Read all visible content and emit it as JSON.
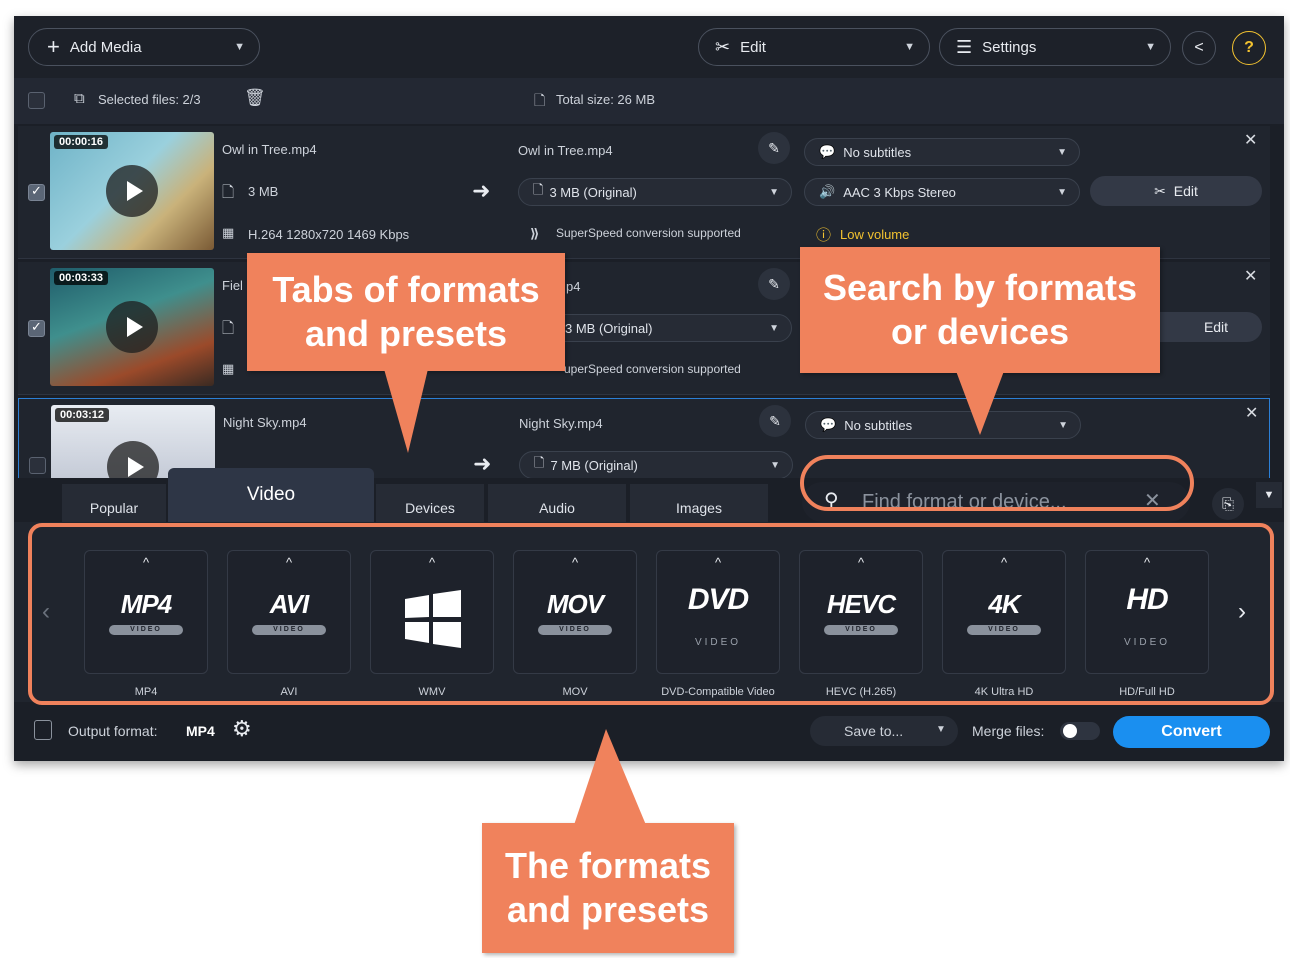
{
  "toolbar": {
    "add_media": "Add Media",
    "edit": "Edit",
    "settings": "Settings",
    "share_icon": "share-icon",
    "help": "?"
  },
  "selection": {
    "selected_files": "Selected files: 2/3",
    "total_size": "Total size: 26 MB"
  },
  "files": [
    {
      "duration": "00:00:16",
      "name": "Owl in Tree.mp4",
      "size": "3 MB",
      "codec": "H.264 1280x720 1469 Kbps",
      "output_name": "Owl in Tree.mp4",
      "output_size": "3 MB (Original)",
      "superspeed": "SuperSpeed conversion supported",
      "subtitles": "No subtitles",
      "audio": "AAC 3 Kbps Stereo",
      "warning": "Low volume",
      "edit": "Edit",
      "checked": true
    },
    {
      "duration": "00:03:33",
      "name": "Fiel",
      "output_name": "p4",
      "output_size": "3 MB (Original)",
      "superspeed": "uperSpeed conversion supported",
      "edit": "Edit",
      "checked": true
    },
    {
      "duration": "00:03:12",
      "name": "Night Sky.mp4",
      "output_name": "Night Sky.mp4",
      "output_size": "7 MB (Original)",
      "subtitles": "No subtitles",
      "checked": false
    }
  ],
  "search": {
    "placeholder": "Find format or device..."
  },
  "tabs": [
    "Popular",
    "Video",
    "Devices",
    "Audio",
    "Images"
  ],
  "formats": [
    {
      "logo": "MP4",
      "label": "MP4"
    },
    {
      "logo": "AVI",
      "label": "AVI"
    },
    {
      "logo": "",
      "label": "WMV"
    },
    {
      "logo": "MOV",
      "label": "MOV"
    },
    {
      "logo": "DVD",
      "label": "DVD-Compatible Video"
    },
    {
      "logo": "HEVC",
      "label": "HEVC (H.265)"
    },
    {
      "logo": "4K",
      "label": "4K Ultra HD"
    },
    {
      "logo": "HD",
      "label": "HD/Full HD"
    }
  ],
  "format_badge": "VIDEO",
  "bottom": {
    "output_format_label": "Output format:",
    "output_format_value": "MP4",
    "save_to": "Save to...",
    "merge_files": "Merge files:",
    "convert": "Convert"
  },
  "callouts": {
    "tabs": "Tabs of formats and presets",
    "search": "Search by formats or devices",
    "formats": "The formats and presets"
  },
  "colors": {
    "accent": "#1a8ff0",
    "callout": "#f0825c",
    "background": "#1b1f27"
  }
}
